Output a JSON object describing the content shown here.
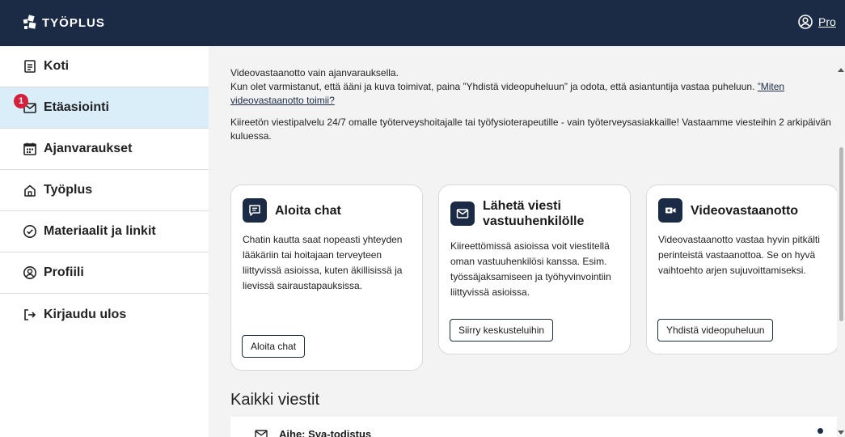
{
  "header": {
    "logo_text": "TYÖPLUS",
    "profile_label": "Pro"
  },
  "sidebar": {
    "items": [
      {
        "label": "Koti",
        "icon": "document-icon"
      },
      {
        "label": "Etäasiointi",
        "icon": "envelope-icon",
        "badge": "1",
        "active": true
      },
      {
        "label": "Ajanvaraukset",
        "icon": "calendar-icon"
      },
      {
        "label": "Työplus",
        "icon": "home-icon"
      },
      {
        "label": "Materiaalit ja linkit",
        "icon": "check-circle-icon"
      },
      {
        "label": "Profiili",
        "icon": "user-circle-icon"
      },
      {
        "label": "Kirjaudu ulos",
        "icon": "logout-icon"
      }
    ]
  },
  "intro": {
    "line1": "Videovastaanotto vain ajanvarauksella.",
    "line2": "Kun olet varmistanut, että ääni ja kuva toimivat, paina ”Yhdistä videopuheluun” ja odota, että asiantuntija vastaa puheluun. ",
    "link": "”Miten videovastaanotto toimii?",
    "line3": "Kiireetön viestipalvelu 24/7 omalle työterveyshoitajalle tai työfysioterapeutille - vain työterveysasiakkaille! Vastaamme viesteihin 2 arkipäivän kuluessa."
  },
  "cards": [
    {
      "title": "Aloita chat",
      "text": "Chatin kautta saat nopeasti yhteyden lääkäriin tai hoitajaan terveyteen liittyvissä asioissa, kuten äkillisissä ja lievissä sairaustapauksissa.",
      "button": "Aloita chat",
      "icon": "chat-icon"
    },
    {
      "title": "Lähetä viesti vastuuhenkilölle",
      "text": "Kiireettömissä asioissa voit viestitellä oman vastuuhenkilösi kanssa. Esim. työssäjaksamiseen ja työhyvinvointiin liittyvissä asioissa.",
      "button": "Siirry keskusteluihin",
      "icon": "envelope-icon"
    },
    {
      "title": "Videovastaanotto",
      "text": "Videovastaanotto vastaa hyvin pitkälti perinteistä vastaanottoa. Se on hyvä vaihtoehto arjen sujuvoittamiseksi.",
      "button": "Yhdistä videopuheluun",
      "icon": "video-icon"
    }
  ],
  "messages": {
    "title": "Kaikki viestit",
    "items": [
      {
        "subject": "Aihe: Sya-todistus",
        "unread": true
      }
    ]
  }
}
